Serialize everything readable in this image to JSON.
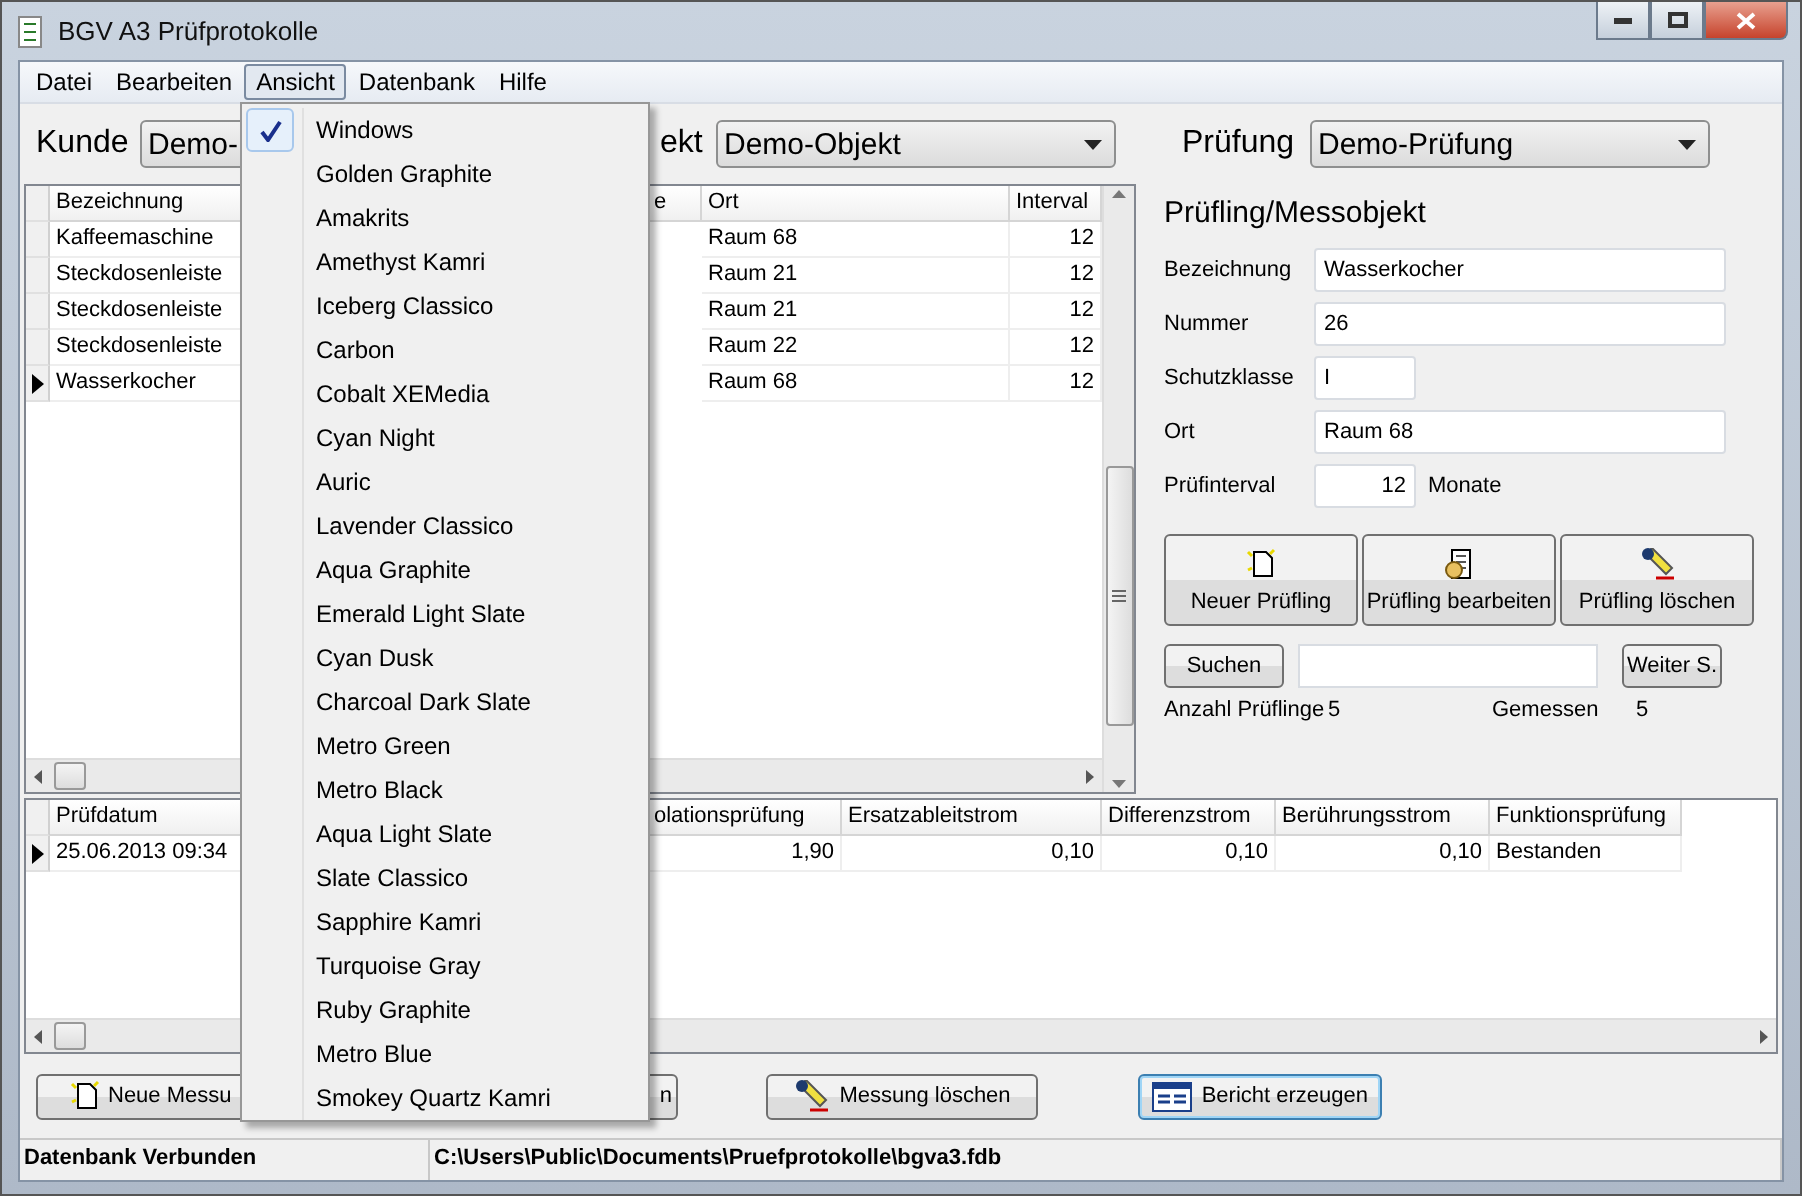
{
  "window": {
    "title": "BGV A3 Prüfprotokolle"
  },
  "menu": [
    {
      "label": "Datei",
      "selected": false
    },
    {
      "label": "Bearbeiten",
      "selected": false
    },
    {
      "label": "Ansicht",
      "selected": true
    },
    {
      "label": "Datenbank",
      "selected": false
    },
    {
      "label": "Hilfe",
      "selected": false
    }
  ],
  "view_menu": {
    "items": [
      {
        "label": "Windows",
        "checked": true
      },
      {
        "label": "Golden Graphite",
        "checked": false
      },
      {
        "label": "Amakrits",
        "checked": false
      },
      {
        "label": "Amethyst Kamri",
        "checked": false
      },
      {
        "label": "Iceberg Classico",
        "checked": false
      },
      {
        "label": "Carbon",
        "checked": false
      },
      {
        "label": "Cobalt XEMedia",
        "checked": false
      },
      {
        "label": "Cyan Night",
        "checked": false
      },
      {
        "label": "Auric",
        "checked": false
      },
      {
        "label": "Lavender Classico",
        "checked": false
      },
      {
        "label": "Aqua Graphite",
        "checked": false
      },
      {
        "label": "Emerald Light Slate",
        "checked": false
      },
      {
        "label": "Cyan Dusk",
        "checked": false
      },
      {
        "label": "Charcoal Dark Slate",
        "checked": false
      },
      {
        "label": "Metro Green",
        "checked": false
      },
      {
        "label": "Metro Black",
        "checked": false
      },
      {
        "label": "Aqua Light Slate",
        "checked": false
      },
      {
        "label": "Slate Classico",
        "checked": false
      },
      {
        "label": "Sapphire Kamri",
        "checked": false
      },
      {
        "label": "Turquoise Gray",
        "checked": false
      },
      {
        "label": "Ruby Graphite",
        "checked": false
      },
      {
        "label": "Metro Blue",
        "checked": false
      },
      {
        "label": "Smokey Quartz Kamri",
        "checked": false
      }
    ]
  },
  "selectors": [
    {
      "label": "Kunde",
      "value": "Demo-"
    },
    {
      "label": "ekt",
      "value": "Demo-Objekt"
    },
    {
      "label": "Prüfung",
      "value": "Demo-Prüfung"
    }
  ],
  "devices_table": {
    "columns": [
      {
        "label": "Bezeichnung",
        "kind": "text"
      },
      {
        "label": "e"
      },
      {
        "label": "Ort",
        "kind": "text"
      },
      {
        "label": "Interval",
        "kind": "number"
      }
    ],
    "rows": [
      {
        "current": false,
        "cells": [
          "Kaffeemaschine",
          "",
          "Raum 68",
          "12"
        ]
      },
      {
        "current": false,
        "cells": [
          "Steckdosenleiste",
          "",
          "Raum 21",
          "12"
        ]
      },
      {
        "current": false,
        "cells": [
          "Steckdosenleiste",
          "",
          "Raum 21",
          "12"
        ]
      },
      {
        "current": false,
        "cells": [
          "Steckdosenleiste",
          "",
          "Raum 22",
          "12"
        ]
      },
      {
        "current": true,
        "cells": [
          "Wasserkocher",
          "",
          "Raum 68",
          "12"
        ]
      }
    ]
  },
  "detail_panel": {
    "title": "Prüfling/Messobjekt",
    "fields": [
      {
        "label": "Bezeichnung",
        "value": "Wasserkocher",
        "kind": "wide"
      },
      {
        "label": "Nummer",
        "value": "26",
        "kind": "wide"
      },
      {
        "label": "Schutzklasse",
        "value": "I",
        "kind": "short"
      },
      {
        "label": "Ort",
        "value": "Raum 68",
        "kind": "wide"
      },
      {
        "label": "Prüfinterval",
        "value": "12",
        "kind": "number",
        "suffix": "Monate"
      }
    ],
    "buttons": [
      {
        "label": "Neuer Prüfling"
      },
      {
        "label": "Prüfling bearbeiten"
      },
      {
        "label": "Prüfling löschen"
      }
    ],
    "search": {
      "button": "Suchen",
      "next": "Weiter S."
    },
    "counts": [
      {
        "label": "Anzahl Prüflinge",
        "value": "5"
      },
      {
        "label": "Gemessen",
        "value": "5"
      }
    ]
  },
  "measurements_table": {
    "columns": [
      {
        "label": "Prüfdatum",
        "kind": "text"
      },
      {
        "label": "olationsprüfung",
        "kind": "number"
      },
      {
        "label": "Ersatzableitstrom",
        "kind": "number"
      },
      {
        "label": "Differenzstrom",
        "kind": "number"
      },
      {
        "label": "Berührungsstrom",
        "kind": "number"
      },
      {
        "label": "Funktionsprüfung",
        "kind": "text"
      }
    ],
    "rows": [
      {
        "current": true,
        "cells": [
          "25.06.2013 09:34",
          "1,90",
          "0,10",
          "0,10",
          "0,10",
          "Bestanden"
        ]
      }
    ]
  },
  "actions": [
    {
      "label": "Neue Messu"
    },
    {
      "label": "n"
    },
    {
      "label": "Messung löschen",
      "focused": false
    },
    {
      "label": "Bericht erzeugen",
      "focused": true
    }
  ],
  "status_bar": [
    "Datenbank Verbunden",
    "C:\\Users\\Public\\Documents\\Pruefprotokolle\\bgva3.fdb"
  ]
}
